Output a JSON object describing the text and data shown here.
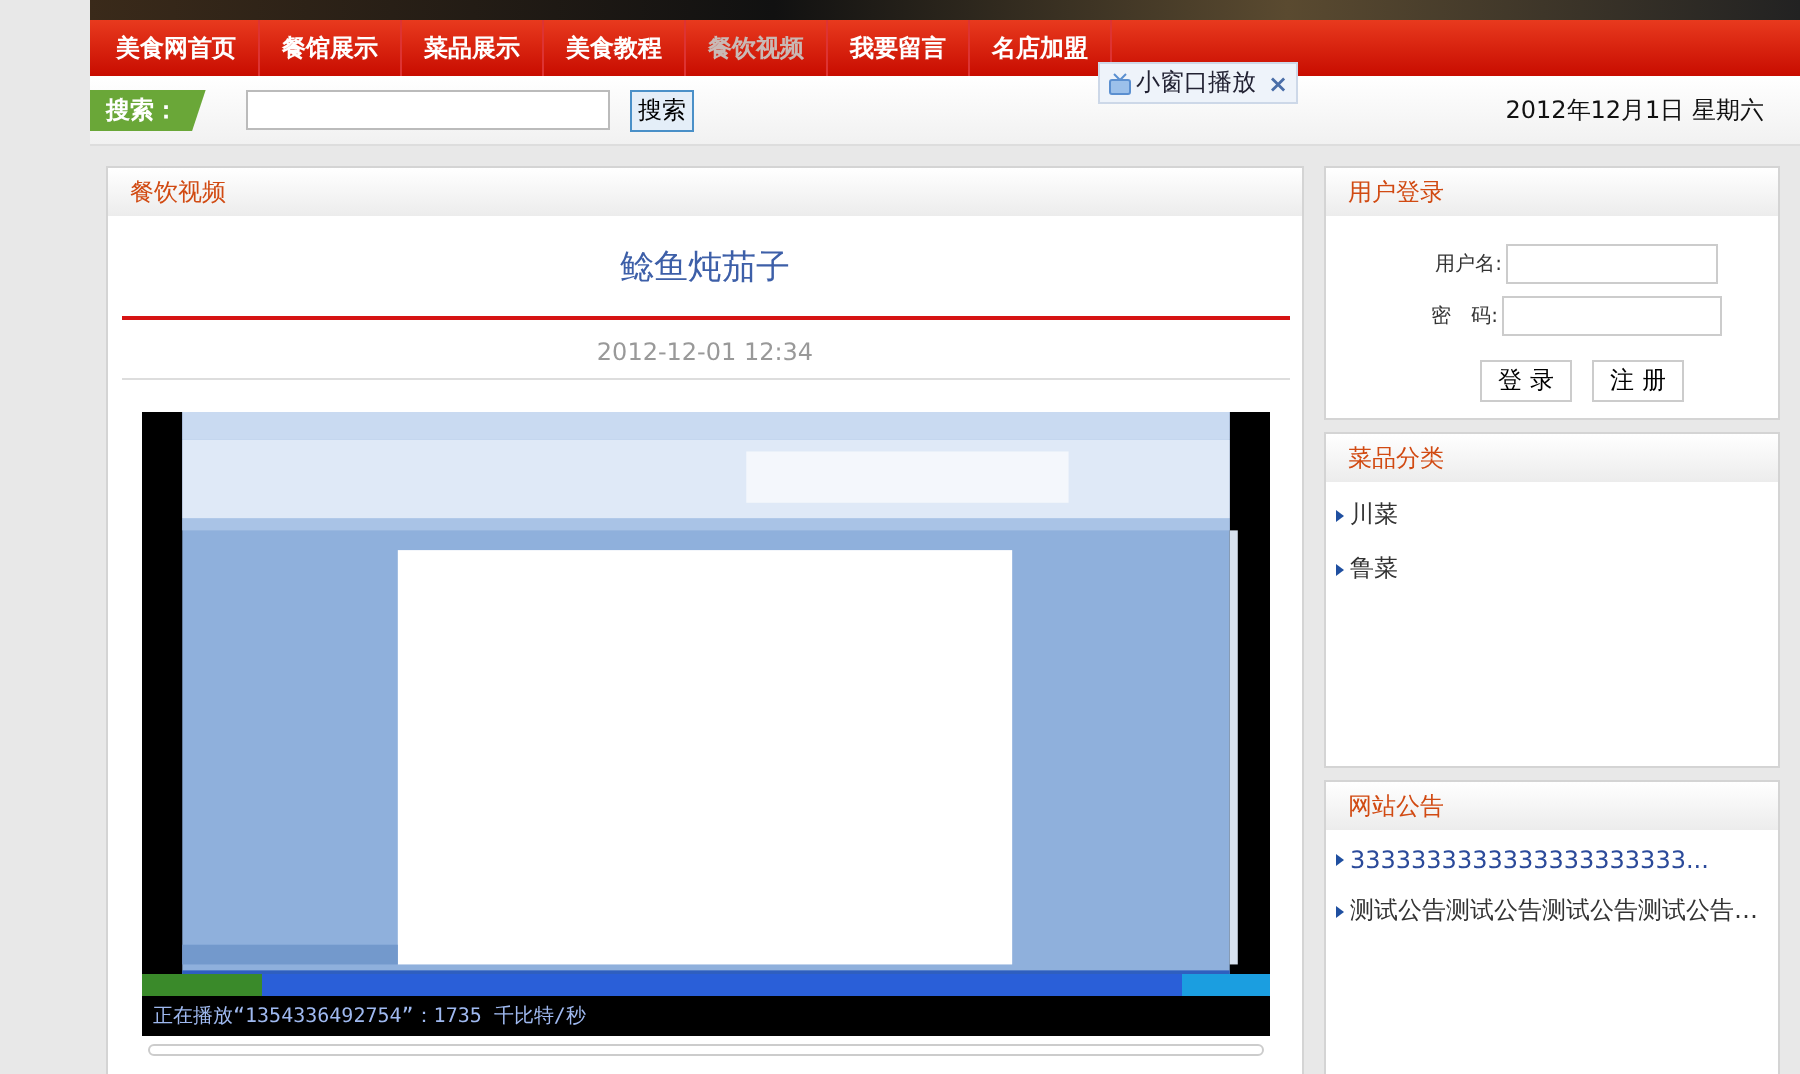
{
  "nav": [
    {
      "label": "美食网首页",
      "selected": false
    },
    {
      "label": "餐馆展示",
      "selected": false
    },
    {
      "label": "菜品展示",
      "selected": false
    },
    {
      "label": "美食教程",
      "selected": false
    },
    {
      "label": "餐饮视频",
      "selected": true
    },
    {
      "label": "我要留言",
      "selected": false
    },
    {
      "label": "名店加盟",
      "selected": false
    }
  ],
  "search": {
    "label": "搜索：",
    "button": "搜索"
  },
  "mini_player": {
    "label": "小窗口播放",
    "close": "×"
  },
  "date": "2012年12月1日 星期六",
  "main": {
    "header": "餐饮视频",
    "title": "鲶鱼炖茄子",
    "time": "2012-12-01 12:34",
    "video": {
      "kind": "picture",
      "status": "正在播放“1354336492754”：1735 千比特/秒"
    }
  },
  "login": {
    "header": "用户登录",
    "username_label": "用户名:",
    "password_label": "密　码:",
    "buttons": [
      "登 录",
      "注 册"
    ]
  },
  "categories": {
    "header": "菜品分类",
    "items": [
      "川菜",
      "鲁菜"
    ]
  },
  "notices": {
    "header": "网站公告",
    "items": [
      "3333333333333333333333...",
      "测试公告测试公告测试公告测试公告…"
    ]
  }
}
